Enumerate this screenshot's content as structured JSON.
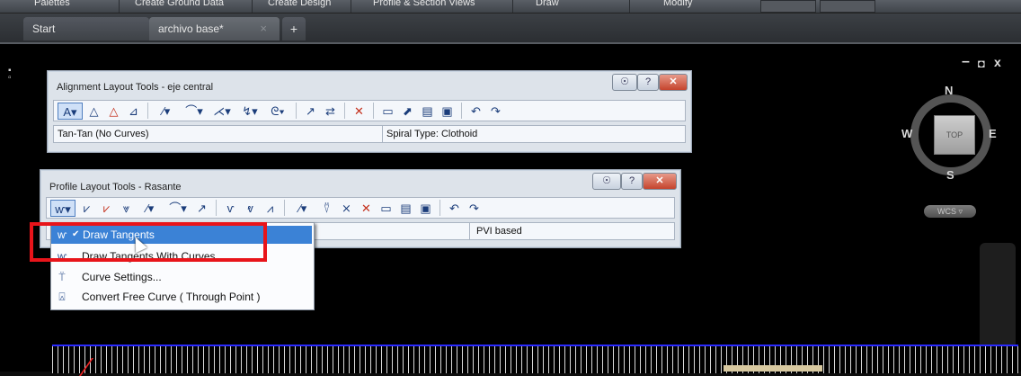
{
  "ribbon": {
    "menus": [
      "Palettes",
      "Create Ground Data",
      "Create Design",
      "Profile & Section Views",
      "Draw",
      "Modify"
    ]
  },
  "tabs": {
    "start": "Start",
    "file": "archivo base*",
    "close": "×",
    "add": "+"
  },
  "window_controls": {
    "minimize": "–",
    "restore": "◘",
    "close": "x"
  },
  "viewcube": {
    "north": "N",
    "south": "S",
    "east": "E",
    "west": "W",
    "top": "TOP",
    "wcs": "WCS ▿"
  },
  "alignment_tools": {
    "title": "Alignment Layout Tools - eje central",
    "status_left": "Tan-Tan (No Curves)",
    "status_right": "Spiral Type: Clothoid",
    "ctl_buttons": [
      "☉",
      "?",
      "✕"
    ]
  },
  "profile_tools": {
    "title": "Profile Layout Tools - Rasante",
    "status_right": "PVI based",
    "ctl_buttons": [
      "☉",
      "?",
      "✕"
    ]
  },
  "dropdown": {
    "items": [
      {
        "label": "Draw Tangents",
        "checked": true,
        "icon": "tangent-icon"
      },
      {
        "label": "Draw Tangents With Curves",
        "icon": "tangent-curve-icon"
      },
      {
        "label": "Curve Settings...",
        "icon": "curve-settings-icon"
      },
      {
        "label": "Convert Free Curve ( Through Point )",
        "icon": "convert-curve-icon"
      }
    ],
    "check_mark": "✔"
  },
  "colors": {
    "highlight": "#3b82d6",
    "annotation_red": "#e8141a",
    "panel": "#dde3ea"
  }
}
